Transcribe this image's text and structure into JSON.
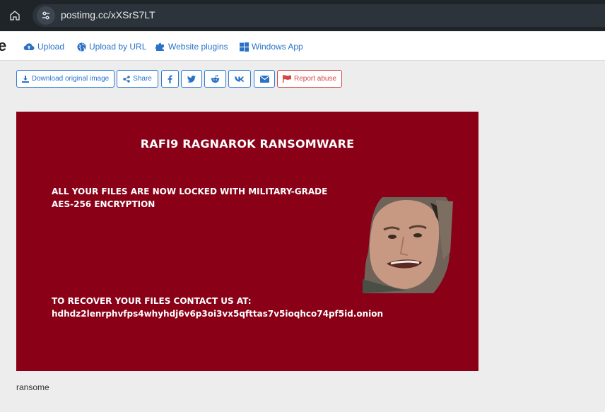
{
  "browser": {
    "url": "postimg.cc/xXSrS7LT"
  },
  "nav": {
    "brand_fragment": "e",
    "items": [
      {
        "label": "Upload",
        "icon": "cloud-upload-icon"
      },
      {
        "label": "Upload by URL",
        "icon": "globe-icon"
      },
      {
        "label": "Website plugins",
        "icon": "puzzle-icon"
      },
      {
        "label": "Windows App",
        "icon": "windows-icon"
      }
    ]
  },
  "actions": {
    "download": "Download original image",
    "share": "Share",
    "report": "Report abuse"
  },
  "image": {
    "title": "RAFI9 RAGNAROK RANSOMWARE",
    "line1": "ALL YOUR FILES ARE NOW LOCKED WITH MILITARY-GRADE",
    "line2": "AES-256 ENCRYPTION",
    "line3": "TO RECOVER YOUR FILES CONTACT US AT:",
    "line4": "hdhdz2lenrphvfps4whyhdj6v6p3oi3vx5qfttas7v5ioqhco74pf5id.onion"
  },
  "caption": "ransome",
  "colors": {
    "accent": "#2a72c8",
    "danger": "#d64545",
    "ransom_bg": "#890017"
  }
}
